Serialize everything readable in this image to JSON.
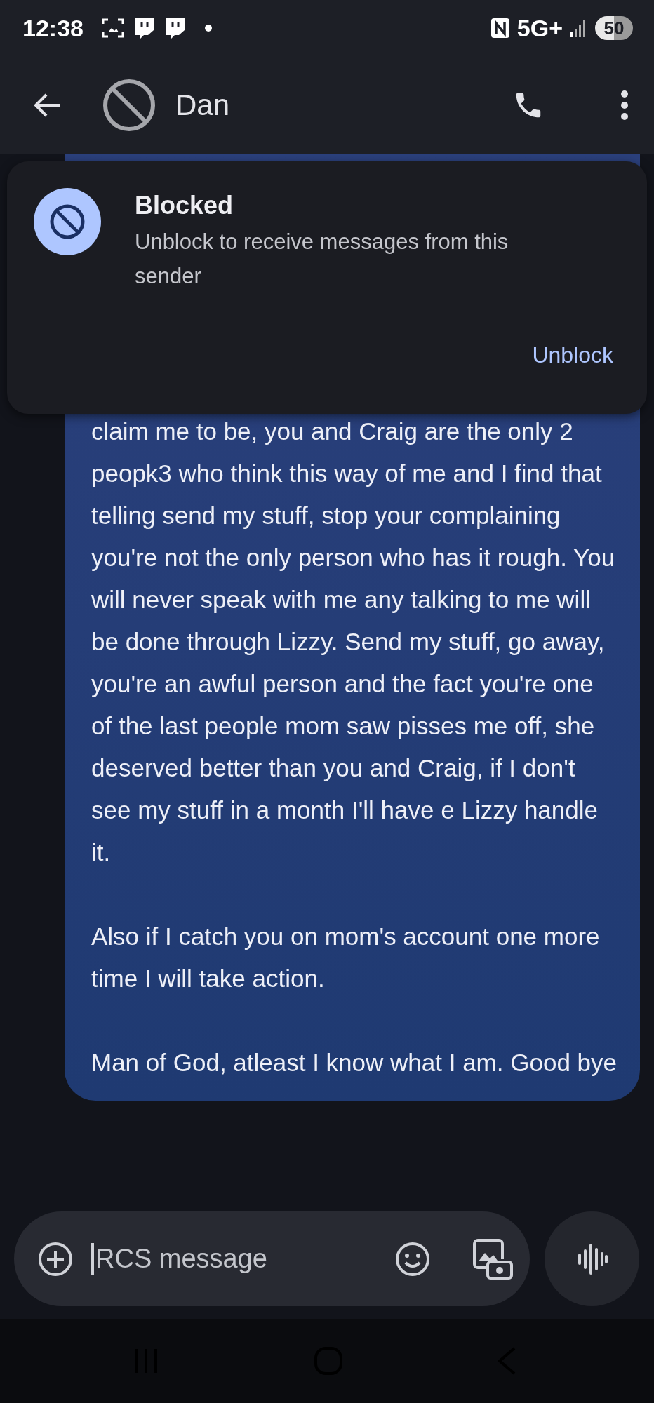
{
  "status_bar": {
    "time": "12:38",
    "network": "5G+",
    "battery": "50"
  },
  "header": {
    "title": "Dan"
  },
  "blocked_notice": {
    "title": "Blocked",
    "message": "Unblock to receive messages from this sender",
    "action": "Unblock"
  },
  "message": {
    "paragraphs": [
      "claim me to be, you and Craig are the only 2 peopk3 who think this way of me and I find that telling send my stuff, stop your complaining you're not the only person who has it rough. You will never speak with me any talking to me will be done through Lizzy. Send my stuff, go away, you're an awful person and the fact you're one of the last people mom saw pisses me off, she deserved better than you and Craig, if I don't see my stuff in a month I'll have e Lizzy handle it.",
      "Also if I catch you on mom's account one more time I will take action.",
      "Man of God, atleast I know what I am. Good bye"
    ]
  },
  "composer": {
    "placeholder": "RCS message"
  }
}
